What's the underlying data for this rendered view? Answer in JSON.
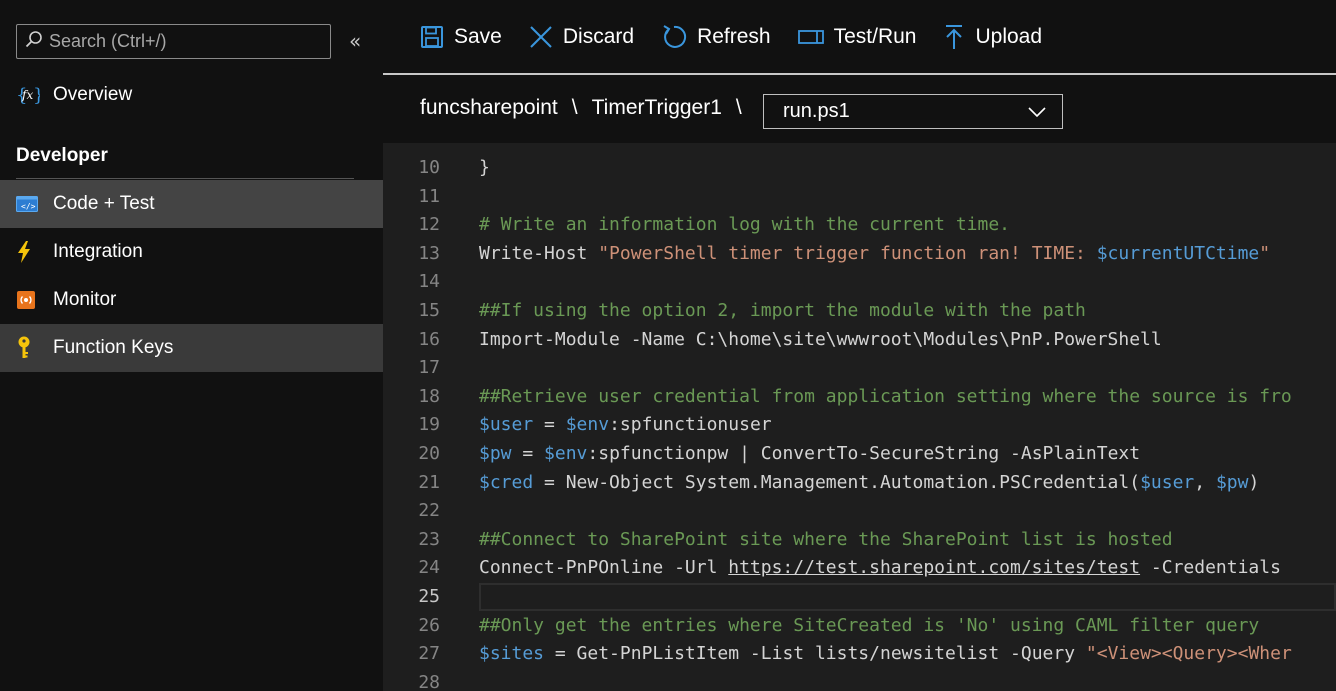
{
  "sidebar": {
    "search_placeholder": "Search (Ctrl+/)",
    "collapse_glyph": "«",
    "overview_label": "Overview",
    "section_title": "Developer",
    "items": [
      {
        "label": "Code + Test",
        "icon": "code-icon"
      },
      {
        "label": "Integration",
        "icon": "lightning-icon"
      },
      {
        "label": "Monitor",
        "icon": "monitor-icon"
      },
      {
        "label": "Function Keys",
        "icon": "key-icon"
      }
    ]
  },
  "toolbar": {
    "save": "Save",
    "discard": "Discard",
    "refresh": "Refresh",
    "test_run": "Test/Run",
    "upload": "Upload"
  },
  "breadcrumb": {
    "app": "funcsharepoint",
    "function": "TimerTrigger1",
    "separator": "\\",
    "file": "run.ps1"
  },
  "editor": {
    "lines": [
      {
        "n": "10",
        "tokens": [
          {
            "t": "}",
            "c": ""
          }
        ]
      },
      {
        "n": "11",
        "tokens": []
      },
      {
        "n": "12",
        "tokens": [
          {
            "t": "# Write an information log with the current time.",
            "c": "c-cmt"
          }
        ]
      },
      {
        "n": "13",
        "tokens": [
          {
            "t": "Write-Host ",
            "c": ""
          },
          {
            "t": "\"PowerShell timer trigger function ran! TIME: ",
            "c": "c-str"
          },
          {
            "t": "$currentUTCtime",
            "c": "c-var"
          },
          {
            "t": "\"",
            "c": "c-str"
          }
        ]
      },
      {
        "n": "14",
        "tokens": []
      },
      {
        "n": "15",
        "tokens": [
          {
            "t": "##If using the option 2, import the module with the path",
            "c": "c-cmt"
          }
        ]
      },
      {
        "n": "16",
        "tokens": [
          {
            "t": "Import-Module -Name C:\\home\\site\\wwwroot\\Modules\\PnP.PowerShell",
            "c": ""
          }
        ]
      },
      {
        "n": "17",
        "tokens": []
      },
      {
        "n": "18",
        "tokens": [
          {
            "t": "##Retrieve user credential from application setting where the source is fro",
            "c": "c-cmt"
          }
        ]
      },
      {
        "n": "19",
        "tokens": [
          {
            "t": "$user",
            "c": "c-var"
          },
          {
            "t": " = ",
            "c": ""
          },
          {
            "t": "$env",
            "c": "c-var"
          },
          {
            "t": ":spfunctionuser",
            "c": ""
          }
        ]
      },
      {
        "n": "20",
        "tokens": [
          {
            "t": "$pw",
            "c": "c-var"
          },
          {
            "t": " = ",
            "c": ""
          },
          {
            "t": "$env",
            "c": "c-var"
          },
          {
            "t": ":spfunctionpw | ConvertTo-SecureString -AsPlainText",
            "c": ""
          }
        ]
      },
      {
        "n": "21",
        "tokens": [
          {
            "t": "$cred",
            "c": "c-var"
          },
          {
            "t": " = New-Object System.Management.Automation.PSCredential(",
            "c": ""
          },
          {
            "t": "$user",
            "c": "c-var"
          },
          {
            "t": ", ",
            "c": ""
          },
          {
            "t": "$pw",
            "c": "c-var"
          },
          {
            "t": ")",
            "c": ""
          }
        ]
      },
      {
        "n": "22",
        "tokens": []
      },
      {
        "n": "23",
        "tokens": [
          {
            "t": "##Connect to SharePoint site where the SharePoint list is hosted",
            "c": "c-cmt"
          }
        ]
      },
      {
        "n": "24",
        "tokens": [
          {
            "t": "Connect-PnPOnline -Url ",
            "c": ""
          },
          {
            "t": "https://test.sharepoint.com/sites/test",
            "c": "c-link"
          },
          {
            "t": " -Credentials ",
            "c": ""
          }
        ]
      },
      {
        "n": "25",
        "tokens": [],
        "current": true
      },
      {
        "n": "26",
        "tokens": [
          {
            "t": "##Only get the entries where SiteCreated is 'No' using CAML filter query",
            "c": "c-cmt"
          }
        ]
      },
      {
        "n": "27",
        "tokens": [
          {
            "t": "$sites",
            "c": "c-var"
          },
          {
            "t": " = Get-PnPListItem -List lists/newsitelist -Query ",
            "c": ""
          },
          {
            "t": "\"<View><Query><Wher",
            "c": "c-str"
          }
        ]
      },
      {
        "n": "28",
        "tokens": []
      }
    ]
  },
  "colors": {
    "sidebar_bg": "#111111",
    "active_item_bg": "#444444",
    "editor_bg": "#1e1e1e",
    "comment": "#6a9955",
    "string": "#ce9178",
    "variable": "#569cd6",
    "accent_icon": "#3a96dd"
  }
}
